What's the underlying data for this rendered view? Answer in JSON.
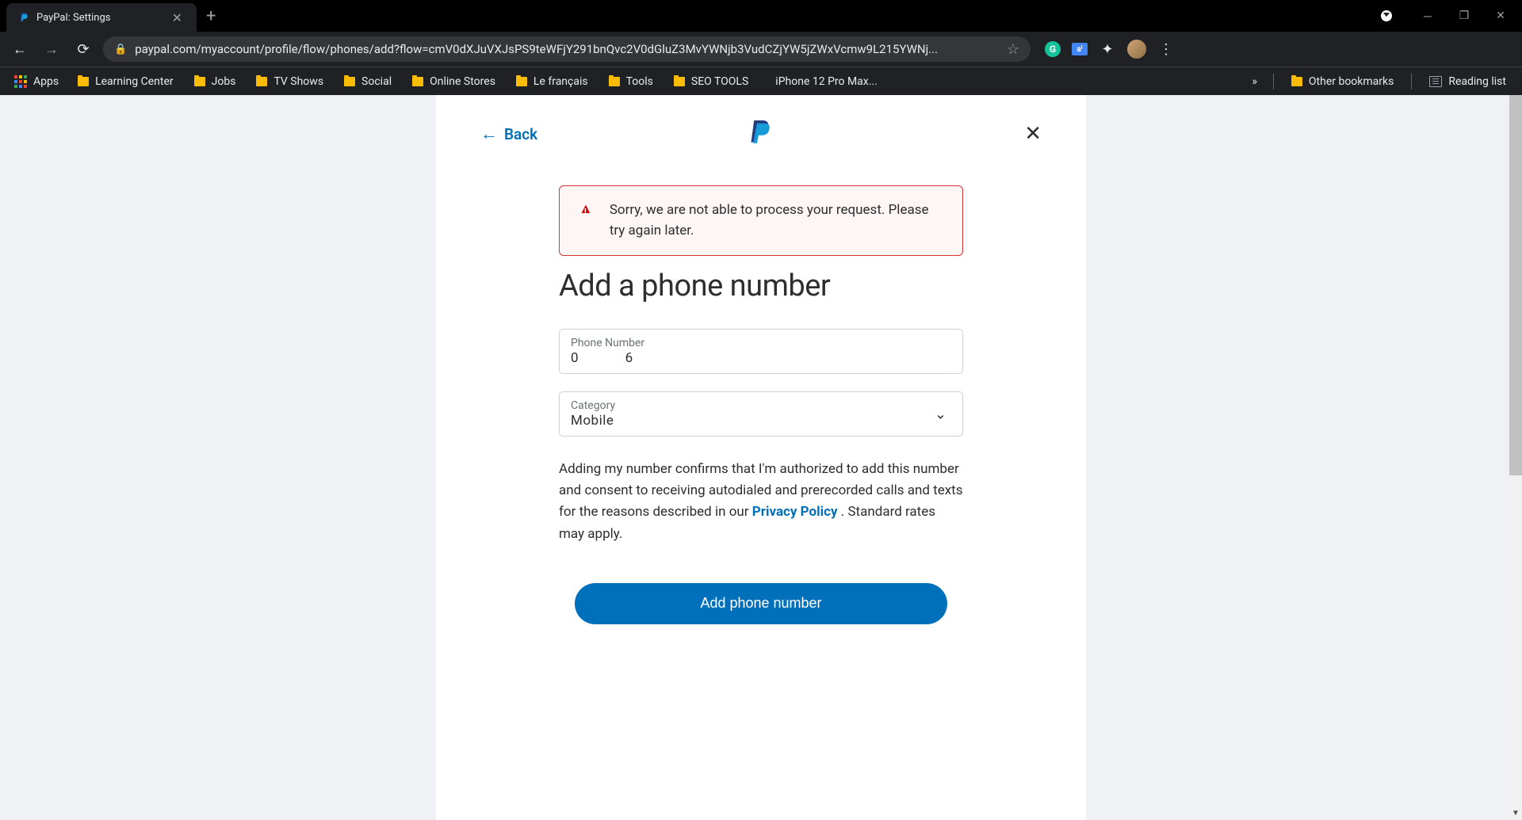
{
  "browser": {
    "tab_title": "PayPal: Settings",
    "url_display": "paypal.com/myaccount/profile/flow/phones/add?flow=cmV0dXJuVXJsPS9teWFjY291bnQvc2V0dGluZ3MvYWNjb3VudCZjYW5jZWxVcmw9L215YWNj...",
    "bookmarks": {
      "apps": "Apps",
      "items": [
        "Learning Center",
        "Jobs",
        "TV Shows",
        "Social",
        "Online Stores",
        "Le français",
        "Tools",
        "SEO TOOLS"
      ],
      "apple_item": "iPhone 12 Pro Max...",
      "other": "Other bookmarks",
      "reading": "Reading list"
    }
  },
  "page": {
    "back_label": "Back",
    "alert_message": "Sorry, we are not able to process your request. Please try again later.",
    "title": "Add a phone number",
    "phone_field": {
      "label": "Phone Number",
      "value": "0              6"
    },
    "category_field": {
      "label": "Category",
      "value": "Mobile"
    },
    "disclaimer_text_1": "Adding my number confirms that I'm authorized to add this number and consent to receiving autodialed and prerecorded calls and texts for the reasons described in our ",
    "privacy_policy_label": "Privacy Policy",
    "disclaimer_text_2": " . Standard rates may apply.",
    "submit_label": "Add phone number"
  }
}
